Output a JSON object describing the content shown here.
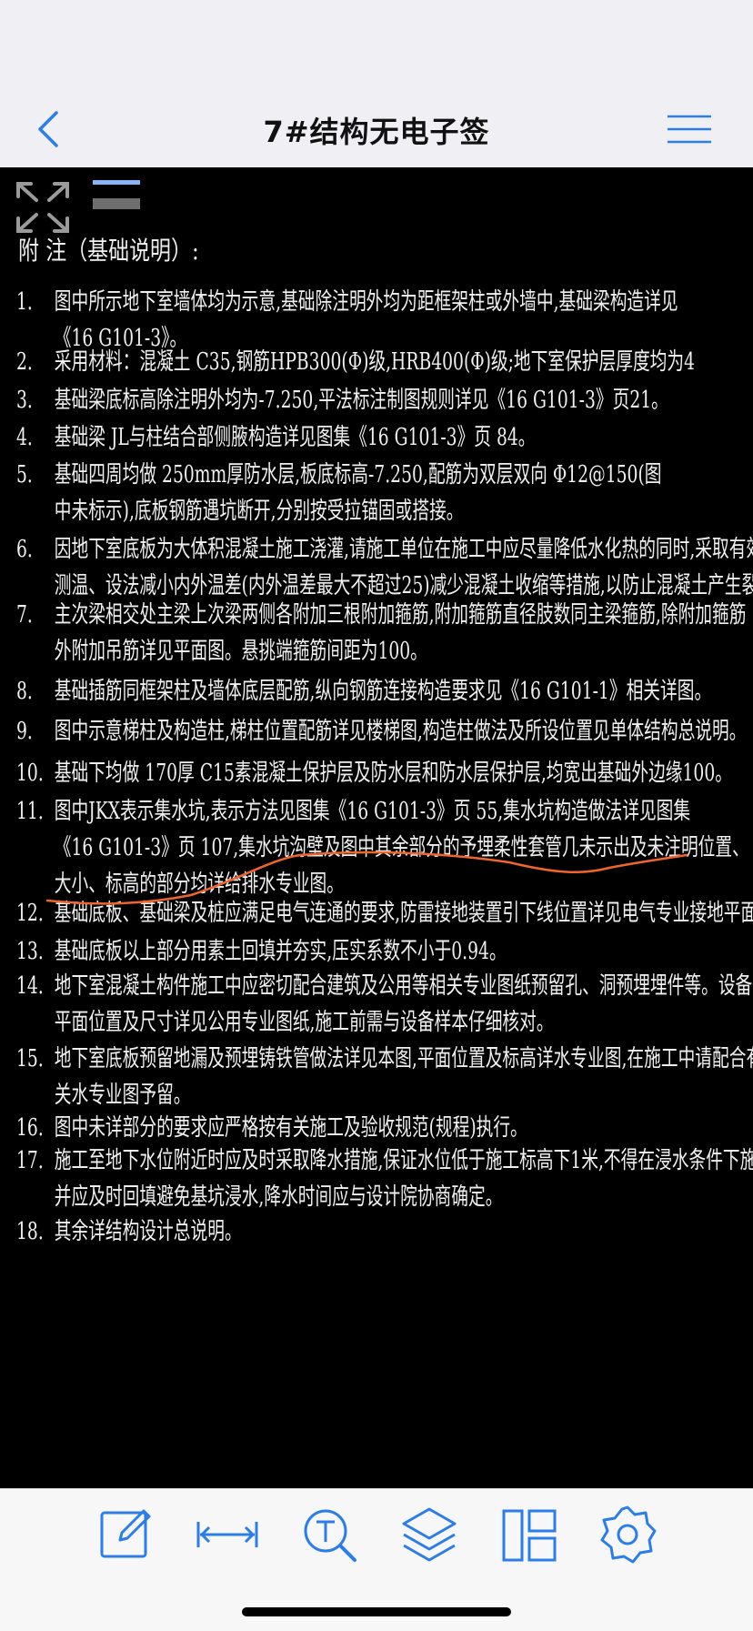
{
  "nav": {
    "title": "7#结构无电子签"
  },
  "drawing": {
    "title": "附  注（基础说明）:",
    "notes": [
      {
        "num": "1.",
        "lines": [
          "图中所示地下室墙体均为示意,基础除注明外均为距框架柱或外墙中,基础梁构造详见",
          "《16 G101-3》。"
        ]
      },
      {
        "num": "2.",
        "lines": [
          "采用材料：混凝土 C35,钢筋HPB300(Φ)级,HRB400(Φ)级;地下室保护层厚度均为4"
        ]
      },
      {
        "num": "3.",
        "lines": [
          "基础梁底标高除注明外均为-7.250,平法标注制图规则详见《16 G101-3》页21。"
        ]
      },
      {
        "num": "4.",
        "lines": [
          "基础梁 JL与柱结合部侧腋构造详见图集《16 G101-3》页 84。"
        ]
      },
      {
        "num": "5.",
        "lines": [
          "基础四周均做 250mm厚防水层,板底标高-7.250,配筋为双层双向 Φ12@150(图",
          "中未标示),底板钢筋遇坑断开,分别按受拉锚固或搭接。"
        ]
      },
      {
        "num": "6.",
        "lines": [
          "因地下室底板为大体积混凝土施工浇灌,请施工单位在施工中应尽量降低水化热的同时,采取有效的",
          "测温、设法减小内外温差(内外温差最大不超过25)减少混凝土收缩等措施,以防止混凝土产生裂缝"
        ]
      },
      {
        "num": "7.",
        "lines": [
          "主次梁相交处主梁上次梁两侧各附加三根附加箍筋,附加箍筋直径肢数同主梁箍筋,除附加箍筋",
          "外附加吊筋详见平面图。悬挑端箍筋间距为100。"
        ]
      },
      {
        "num": "8.",
        "lines": [
          "基础插筋同框架柱及墙体底层配筋,纵向钢筋连接构造要求见《16 G101-1》相关详图。"
        ]
      },
      {
        "num": "9.",
        "lines": [
          "图中示意梯柱及构造柱,梯柱位置配筋详见楼梯图,构造柱做法及所设位置见单体结构总说明。"
        ]
      },
      {
        "num": "10.",
        "lines": [
          "基础下均做 170厚 C15素混凝土保护层及防水层和防水层保护层,均宽出基础外边缘100。"
        ]
      },
      {
        "num": "11.",
        "lines": [
          "图中JKX表示集水坑,表示方法见图集《16 G101-3》页 55,集水坑构造做法详见图集",
          "《16 G101-3》页 107,集水坑沟壁及图中其余部分的予埋柔性套管几未示出及未注明位置、",
          "大小、标高的部分均详给排水专业图。"
        ]
      },
      {
        "num": "12.",
        "lines": [
          "基础底板、基础梁及桩应满足电气连通的要求,防雷接地装置引下线位置详见电气专业接地平面图。"
        ]
      },
      {
        "num": "13.",
        "lines": [
          "基础底板以上部分用素土回填并夯实,压实系数不小于0.94。"
        ]
      },
      {
        "num": "14.",
        "lines": [
          "地下室混凝土构件施工中应密切配合建筑及公用等相关专业图纸预留孔、洞预埋埋件等。设备基础",
          "平面位置及尺寸详见公用专业图纸,施工前需与设备样本仔细核对。"
        ]
      },
      {
        "num": "15.",
        "lines": [
          "地下室底板预留地漏及预埋铸铁管做法详见本图,平面位置及标高详水专业图,在施工中请配合有",
          "关水专业图予留。"
        ]
      },
      {
        "num": "16.",
        "lines": [
          "图中未详部分的要求应严格按有关施工及验收规范(规程)执行。"
        ]
      },
      {
        "num": "17.",
        "lines": [
          "施工至地下水位附近时应及时采取降水措施,保证水位低于施工标高下1米,不得在浸水条件下施工。",
          "并应及时回填避免基坑浸水,降水时间应与设计院协商确定。"
        ]
      },
      {
        "num": "18.",
        "lines": [
          "其余详结构设计总说明。"
        ]
      }
    ]
  },
  "colors": {
    "accent": "#2b7de9",
    "annotation": "#f0652a",
    "drawing_bg": "#000000",
    "drawing_text": "#f0f0f0"
  },
  "icons": {
    "back": "chevron-left-icon",
    "menu": "hamburger-menu-icon",
    "fit": "expand-arrows-icon",
    "toolbar": [
      "edit-icon",
      "measure-icon",
      "text-search-icon",
      "layers-icon",
      "layout-icon",
      "settings-icon"
    ]
  }
}
